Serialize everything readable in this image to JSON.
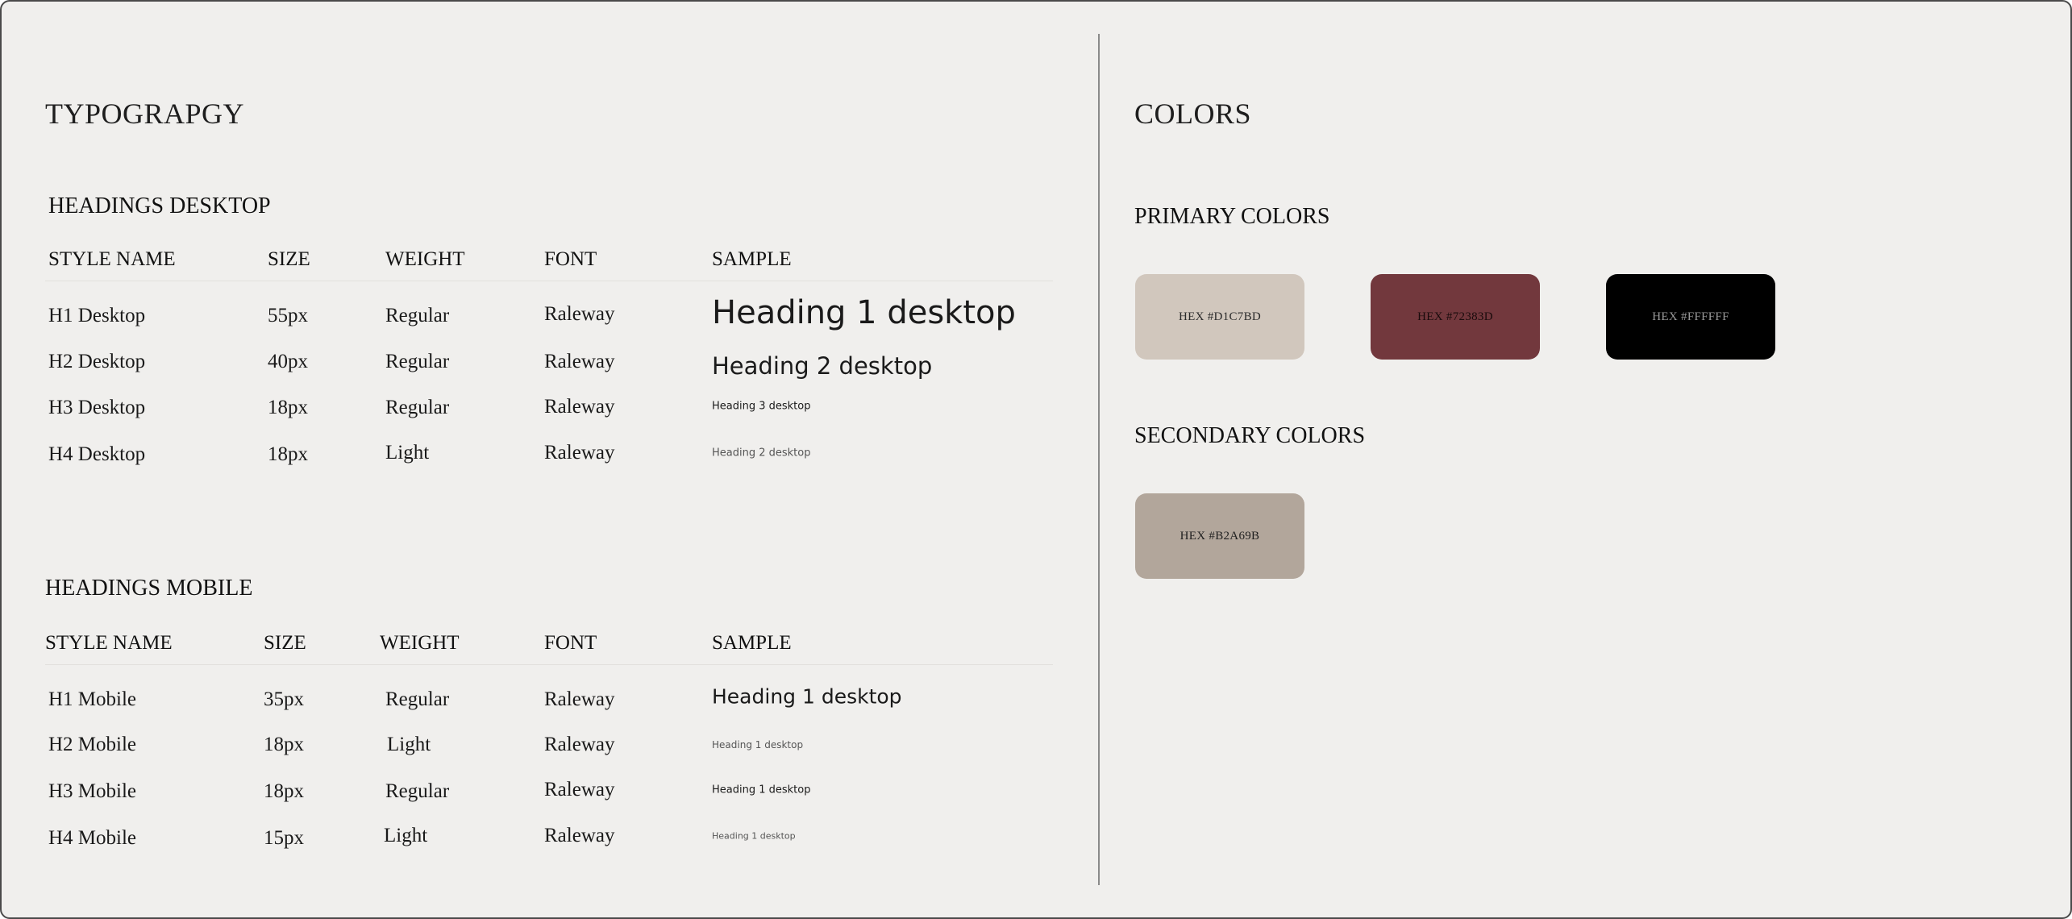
{
  "typography": {
    "title": "TYPOGRAPGY",
    "desktop": {
      "title": "HEADINGS DESKTOP",
      "headers": {
        "style": "STYLE NAME",
        "size": "SIZE",
        "weight": "WEIGHT",
        "font": "FONT",
        "sample": "SAMPLE"
      },
      "rows": [
        {
          "style": "H1 Desktop",
          "size": "55px",
          "weight": "Regular",
          "font": "Raleway",
          "sample": "Heading 1 desktop"
        },
        {
          "style": "H2 Desktop",
          "size": "40px",
          "weight": "Regular",
          "font": "Raleway",
          "sample": "Heading 2 desktop"
        },
        {
          "style": "H3 Desktop",
          "size": "18px",
          "weight": "Regular",
          "font": "Raleway",
          "sample": "Heading 3 desktop"
        },
        {
          "style": "H4 Desktop",
          "size": "18px",
          "weight": "Light",
          "font": "Raleway",
          "sample": "Heading 2 desktop"
        }
      ]
    },
    "mobile": {
      "title": "HEADINGS MOBILE",
      "headers": {
        "style": "STYLE NAME",
        "size": "SIZE",
        "weight": "WEIGHT",
        "font": "FONT",
        "sample": "SAMPLE"
      },
      "rows": [
        {
          "style": "H1 Mobile",
          "size": "35px",
          "weight": "Regular",
          "font": "Raleway",
          "sample": "Heading 1 desktop"
        },
        {
          "style": "H2 Mobile",
          "size": "18px",
          "weight": "Light",
          "font": "Raleway",
          "sample": "Heading 1 desktop"
        },
        {
          "style": "H3 Mobile",
          "size": "18px",
          "weight": "Regular",
          "font": "Raleway",
          "sample": "Heading 1 desktop"
        },
        {
          "style": "H4 Mobile",
          "size": "15px",
          "weight": "Light",
          "font": "Raleway",
          "sample": "Heading 1 desktop"
        }
      ]
    }
  },
  "colors": {
    "title": "COLORS",
    "primary": {
      "title": "PRIMARY COLORS",
      "swatches": [
        {
          "label": "HEX #D1C7BD",
          "color": "#D1C7BD",
          "text_color": "#2a2a2a"
        },
        {
          "label": "HEX #72383D",
          "color": "#72383D",
          "text_color": "#1a0b0c"
        },
        {
          "label": "HEX #FFFFFF",
          "color": "#000000",
          "text_color": "#9a9a9a"
        }
      ]
    },
    "secondary": {
      "title": "SECONDARY COLORS",
      "swatches": [
        {
          "label": "HEX #B2A69B",
          "color": "#B2A69B",
          "text_color": "#1f1f1f"
        }
      ]
    }
  }
}
